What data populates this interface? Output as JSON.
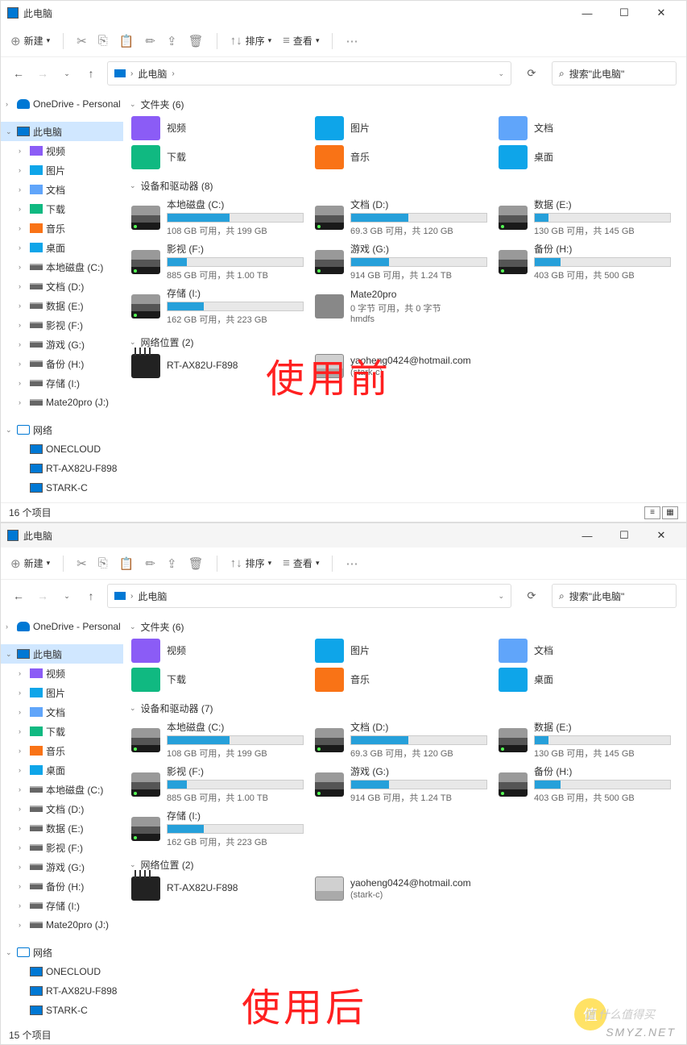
{
  "window1": {
    "title": "此电脑",
    "new_btn": "新建",
    "sort_btn": "排序",
    "view_btn": "查看",
    "breadcrumb": "此电脑",
    "search_placeholder": "搜索\"此电脑\"",
    "status": "16 个项目",
    "overlay": "使用前",
    "sidebar": {
      "onedrive": "OneDrive - Personal",
      "thispc": "此电脑",
      "items": [
        "视频",
        "图片",
        "文档",
        "下载",
        "音乐",
        "桌面",
        "本地磁盘 (C:)",
        "文档 (D:)",
        "数据 (E:)",
        "影视 (F:)",
        "游戏 (G:)",
        "备份 (H:)",
        "存储 (I:)",
        "Mate20pro (J:)"
      ],
      "network": "网络",
      "net_items": [
        "ONECLOUD",
        "RT-AX82U-F898",
        "STARK-C"
      ]
    },
    "groups": {
      "folders": "文件夹 (6)",
      "drives": "设备和驱动器 (8)",
      "network": "网络位置 (2)"
    },
    "folders": [
      {
        "name": "视频",
        "ico": "ico-video"
      },
      {
        "name": "图片",
        "ico": "ico-images"
      },
      {
        "name": "文档",
        "ico": "ico-docs"
      },
      {
        "name": "下载",
        "ico": "ico-download"
      },
      {
        "name": "音乐",
        "ico": "ico-music"
      },
      {
        "name": "桌面",
        "ico": "ico-desktop"
      }
    ],
    "drives": [
      {
        "name": "本地磁盘 (C:)",
        "sub": "108 GB 可用，共 199 GB",
        "pct": 46
      },
      {
        "name": "文档 (D:)",
        "sub": "69.3 GB 可用，共 120 GB",
        "pct": 42
      },
      {
        "name": "数据 (E:)",
        "sub": "130 GB 可用，共 145 GB",
        "pct": 10
      },
      {
        "name": "影视 (F:)",
        "sub": "885 GB 可用，共 1.00 TB",
        "pct": 14
      },
      {
        "name": "游戏 (G:)",
        "sub": "914 GB 可用，共 1.24 TB",
        "pct": 28
      },
      {
        "name": "备份 (H:)",
        "sub": "403 GB 可用，共 500 GB",
        "pct": 19
      },
      {
        "name": "存储 (I:)",
        "sub": "162 GB 可用，共 223 GB",
        "pct": 27
      },
      {
        "name": "Mate20pro",
        "sub": "0 字节 可用，共 0 字节",
        "sub2": "hmdfs",
        "pct": 0,
        "phone": true
      }
    ],
    "netloc": [
      {
        "name": "RT-AX82U-F898",
        "router": true
      },
      {
        "name": "yaoheng0424@hotmail.com",
        "sub": "(stark-c)"
      }
    ]
  },
  "window2": {
    "title": "此电脑",
    "status": "15 个项目",
    "overlay": "使用后",
    "groups": {
      "folders": "文件夹 (6)",
      "drives": "设备和驱动器 (7)",
      "network": "网络位置 (2)"
    },
    "sidebar_items": [
      "视频",
      "图片",
      "文档",
      "下载",
      "音乐",
      "桌面",
      "本地磁盘 (C:)",
      "文档 (D:)",
      "数据 (E:)",
      "影视 (F:)",
      "游戏 (G:)",
      "备份 (H:)",
      "存储 (I:)",
      "Mate20pro (J:)"
    ],
    "drives": [
      {
        "name": "本地磁盘 (C:)",
        "sub": "108 GB 可用，共 199 GB",
        "pct": 46
      },
      {
        "name": "文档 (D:)",
        "sub": "69.3 GB 可用，共 120 GB",
        "pct": 42
      },
      {
        "name": "数据 (E:)",
        "sub": "130 GB 可用，共 145 GB",
        "pct": 10
      },
      {
        "name": "影视 (F:)",
        "sub": "885 GB 可用，共 1.00 TB",
        "pct": 14
      },
      {
        "name": "游戏 (G:)",
        "sub": "914 GB 可用，共 1.24 TB",
        "pct": 28
      },
      {
        "name": "备份 (H:)",
        "sub": "403 GB 可用，共 500 GB",
        "pct": 19
      },
      {
        "name": "存储 (I:)",
        "sub": "162 GB 可用，共 223 GB",
        "pct": 27
      }
    ]
  },
  "watermark": {
    "text1": "值 什么值得买",
    "text2": "SMYZ.NET"
  }
}
